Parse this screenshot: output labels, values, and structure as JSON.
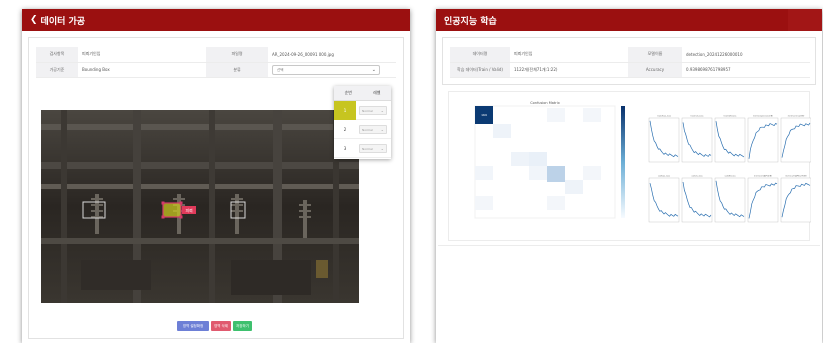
{
  "left_window": {
    "title": "데이터 가공",
    "back_icon": "chevron-left-icon",
    "info": {
      "rows": [
        {
          "label1": "검사항목",
          "value1": "피뢰기인입",
          "label2": "파일명",
          "value2": "AR_2024-09-26_00091 000.jpg"
        },
        {
          "label1": "가공기준",
          "value1": "Bounding Box",
          "label2": "분류"
        }
      ],
      "class_select": {
        "value": "선택"
      }
    },
    "levels": {
      "headers": [
        "순번",
        "레벨"
      ],
      "rows": [
        {
          "no": "1",
          "status": "Normal"
        },
        {
          "no": "2",
          "status": "Normal"
        },
        {
          "no": "3",
          "status": "Normal"
        }
      ]
    },
    "bbox_tag": "피뢰",
    "buttons": {
      "bbox_label": "영역 설정확정",
      "delete_label": "영역 삭제",
      "save_label": "저장하기"
    }
  },
  "right_window": {
    "title": "인공지능 학습",
    "info": {
      "rows": [
        {
          "label1": "데이터명",
          "value1": "피뢰기인입",
          "label2": "모델이름",
          "value2": "detection_20241226000010"
        },
        {
          "label1": "학습 데이터(Train / Valid)",
          "value1": "1122개(전체71개:1:22)",
          "label2": "Accuracy",
          "value2": "0.9398698761798957"
        }
      ]
    },
    "confusion_matrix": {
      "title": "Confusion Matrix",
      "top_value": "169"
    },
    "training_curves": {
      "titles": [
        "train/box_loss",
        "train/cls_loss",
        "train/dfl_loss",
        "metrics/precision(B)",
        "metrics/recall(B)",
        "val/box_loss",
        "val/cls_loss",
        "val/dfl_loss",
        "metrics/mAP50(B)",
        "metrics/mAP50-95(B)"
      ]
    }
  },
  "colors": {
    "titlebar": "#9b1010",
    "highlight": "#c7c520",
    "cm_dark": "#0b3a73"
  }
}
